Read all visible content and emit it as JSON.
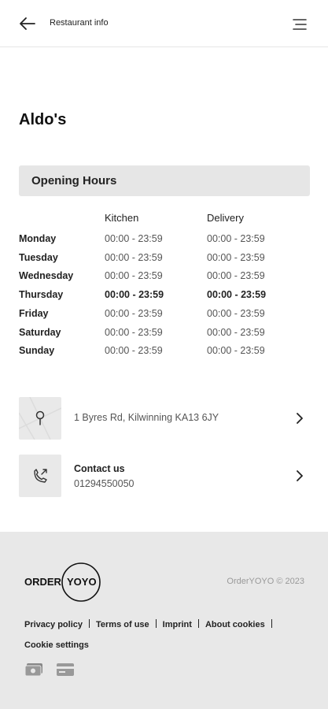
{
  "header": {
    "title": "Restaurant info",
    "back_icon": "arrow-left-icon",
    "menu_icon": "hamburger-menu-icon"
  },
  "restaurant": {
    "name": "Aldo's"
  },
  "opening_hours": {
    "title": "Opening Hours",
    "columns": {
      "kitchen": "Kitchen",
      "delivery": "Delivery"
    },
    "days": [
      {
        "day": "Monday",
        "kitchen": "00:00 - 23:59",
        "delivery": "00:00 - 23:59",
        "today": false
      },
      {
        "day": "Tuesday",
        "kitchen": "00:00 - 23:59",
        "delivery": "00:00 - 23:59",
        "today": false
      },
      {
        "day": "Wednesday",
        "kitchen": "00:00 - 23:59",
        "delivery": "00:00 - 23:59",
        "today": false
      },
      {
        "day": "Thursday",
        "kitchen": "00:00 - 23:59",
        "delivery": "00:00 - 23:59",
        "today": true
      },
      {
        "day": "Friday",
        "kitchen": "00:00 - 23:59",
        "delivery": "00:00 - 23:59",
        "today": false
      },
      {
        "day": "Saturday",
        "kitchen": "00:00 - 23:59",
        "delivery": "00:00 - 23:59",
        "today": false
      },
      {
        "day": "Sunday",
        "kitchen": "00:00 - 23:59",
        "delivery": "00:00 - 23:59",
        "today": false
      }
    ]
  },
  "address": {
    "text": "1 Byres Rd, Kilwinning KA13 6JY",
    "icon": "map-pin-icon"
  },
  "contact": {
    "title": "Contact us",
    "phone": "01294550050",
    "icon": "phone-callback-icon"
  },
  "footer": {
    "logo_left": "ORDER",
    "logo_right": "YOYO",
    "copyright": "OrderYOYO © 2023",
    "links": [
      "Privacy policy",
      "Terms of use",
      "Imprint",
      "About cookies",
      "Cookie settings"
    ],
    "payment_icons": [
      "cash-icon",
      "card-icon"
    ]
  },
  "colors": {
    "footer_bg": "#e8e8e8",
    "section_header_bg": "#e6e6e6",
    "muted_text": "#555555"
  }
}
